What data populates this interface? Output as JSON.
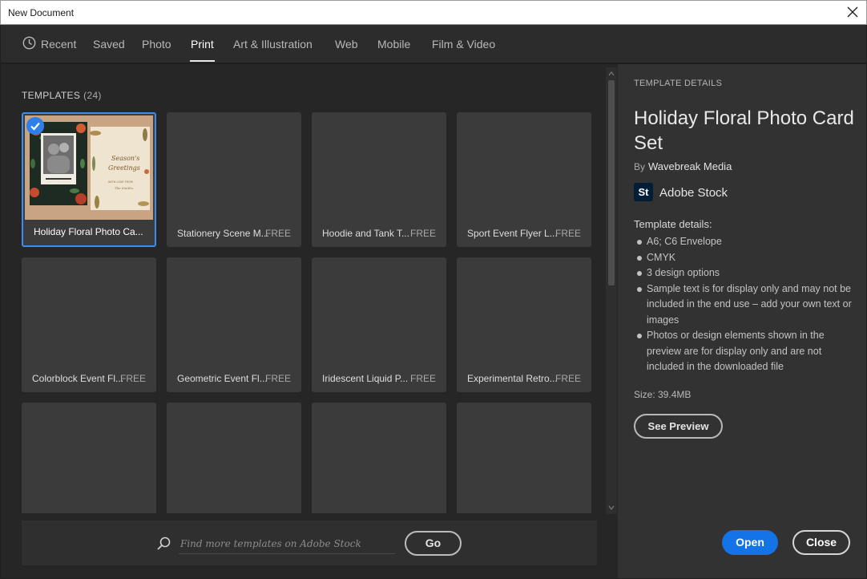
{
  "window": {
    "title": "New Document"
  },
  "tabs": [
    {
      "label": "Recent",
      "icon": "clock-icon"
    },
    {
      "label": "Saved"
    },
    {
      "label": "Photo"
    },
    {
      "label": "Print",
      "active": true
    },
    {
      "label": "Art & Illustration"
    },
    {
      "label": "Web"
    },
    {
      "label": "Mobile"
    },
    {
      "label": "Film & Video"
    }
  ],
  "templates": {
    "heading": "TEMPLATES",
    "count": "(24)",
    "items": [
      {
        "name": "Holiday Floral Photo Ca...",
        "badge": "",
        "selected": true
      },
      {
        "name": "Stationery Scene M...",
        "badge": "FREE"
      },
      {
        "name": "Hoodie and Tank T...",
        "badge": "FREE"
      },
      {
        "name": "Sport Event Flyer L...",
        "badge": "FREE"
      },
      {
        "name": "Colorblock Event Fl...",
        "badge": "FREE"
      },
      {
        "name": "Geometric Event Fl...",
        "badge": "FREE"
      },
      {
        "name": "Iridescent Liquid P...",
        "badge": "FREE"
      },
      {
        "name": "Experimental Retro...",
        "badge": "FREE"
      },
      {
        "name": "",
        "badge": ""
      },
      {
        "name": "",
        "badge": ""
      },
      {
        "name": "",
        "badge": ""
      },
      {
        "name": "",
        "badge": ""
      }
    ],
    "thumbnail_text": {
      "line1": "Season's",
      "line2": "Greetings",
      "line3": "WITH LOVE FROM",
      "line4": "The Smiths",
      "card_text": "HAPPY HOLIDAYS"
    }
  },
  "search": {
    "placeholder": "Find more templates on Adobe Stock",
    "go_label": "Go"
  },
  "details": {
    "heading": "TEMPLATE DETAILS",
    "title": "Holiday Floral Photo Card Set",
    "by_label": "By",
    "author": "Wavebreak Media",
    "stock_logo": "St",
    "stock_name": "Adobe Stock",
    "list_label": "Template details:",
    "items": [
      "A6; C6 Envelope",
      "CMYK",
      "3 design options",
      "Sample text is for display only and may not be included in the end use – add your own text or images",
      "Photos or design elements shown in the preview are for display only and are not included in the downloaded file"
    ],
    "size": "Size: 39.4MB",
    "preview_label": "See Preview"
  },
  "footer": {
    "open_label": "Open",
    "close_label": "Close"
  },
  "colors": {
    "accent": "#1473e6",
    "selection": "#3b8cf3",
    "stock_logo_bg": "#001e36"
  }
}
